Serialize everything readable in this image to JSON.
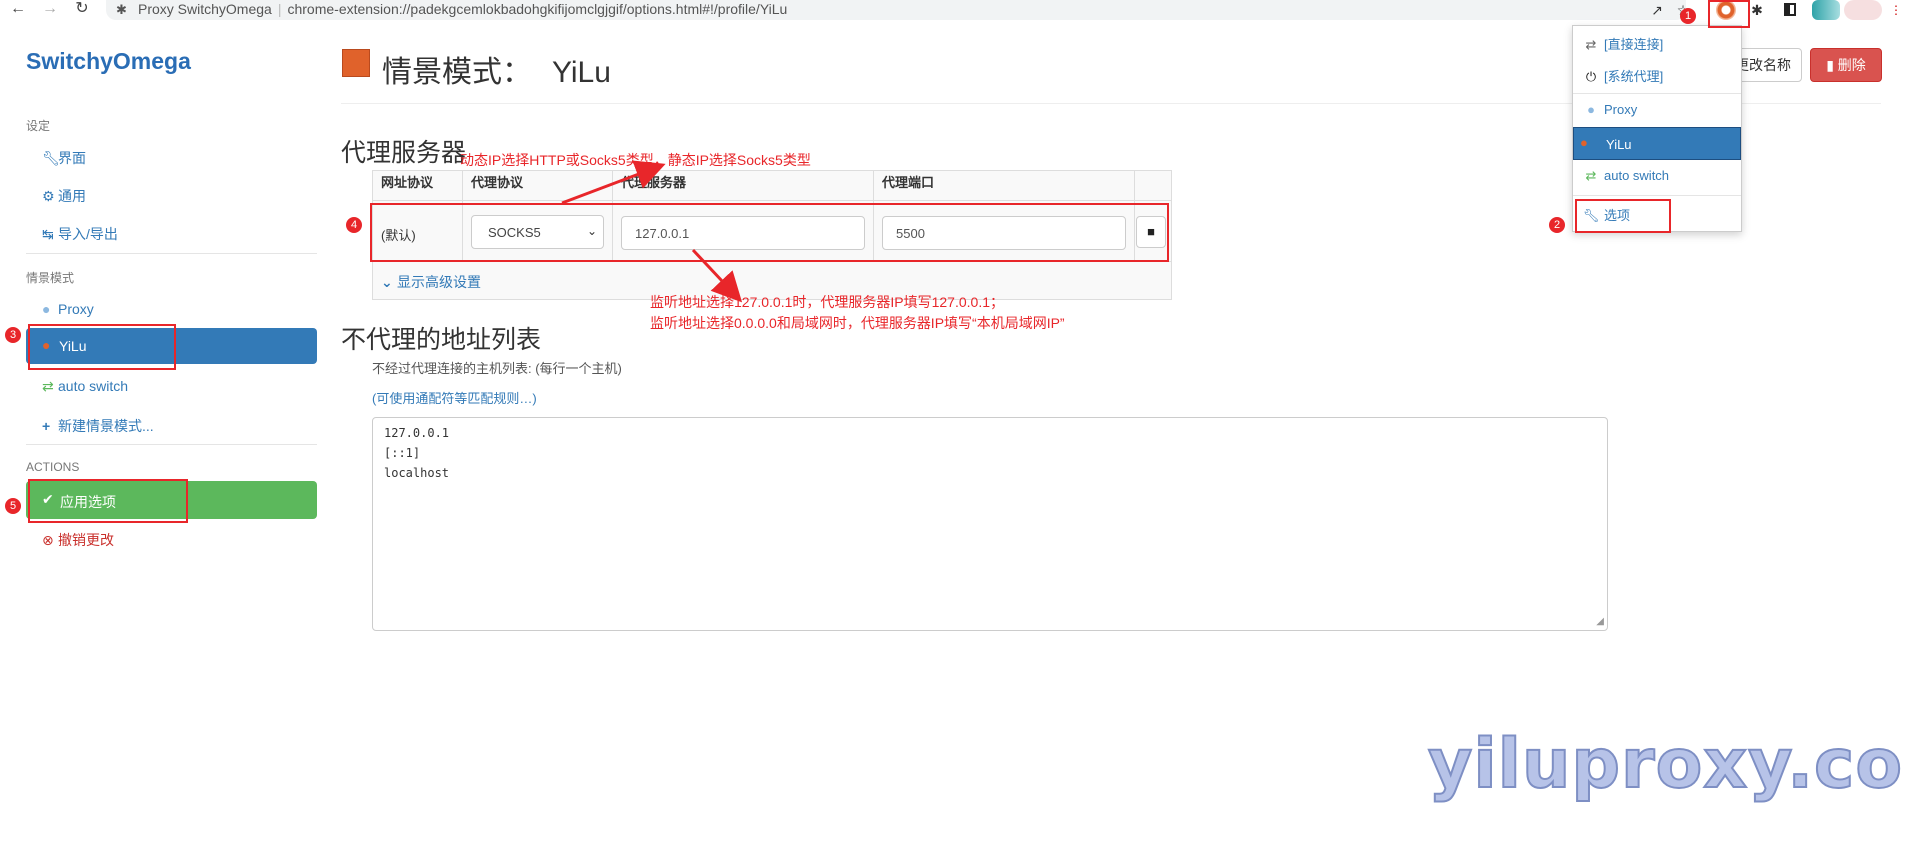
{
  "browser": {
    "tab_title": "Proxy SwitchyOmega",
    "url": "chrome-extension://padekgcemlokbadohgkifijomclgjgif/options.html#!/profile/YiLu"
  },
  "sidebar": {
    "brand": "SwitchyOmega",
    "settings_header": "设定",
    "settings_items": [
      {
        "label": "界面",
        "icon": "wrench-icon"
      },
      {
        "label": "通用",
        "icon": "gear-icon"
      },
      {
        "label": "导入/导出",
        "icon": "import-export-icon"
      }
    ],
    "profiles_header": "情景模式",
    "profiles": [
      {
        "label": "Proxy",
        "icon": "globe-icon"
      },
      {
        "label": "YiLu",
        "icon": "globe-icon",
        "active": true
      },
      {
        "label": "auto switch",
        "icon": "retweet-icon"
      }
    ],
    "new_profile": "新建情景模式...",
    "actions_header": "ACTIONS",
    "apply": "应用选项",
    "discard": "撤销更改"
  },
  "header": {
    "title_prefix": "情景模式：",
    "profile_name": "YiLu",
    "rename_button": "更改名称",
    "delete_button": "删除",
    "profile_color": "#e0622b"
  },
  "proxy_section": {
    "title": "代理服务器",
    "columns": [
      "网址协议",
      "代理协议",
      "代理服务器",
      "代理端口"
    ],
    "row": {
      "scheme": "(默认)",
      "protocol": "SOCKS5",
      "server": "127.0.0.1",
      "port": "5500"
    },
    "advanced": "显示高级设置"
  },
  "bypass_section": {
    "title": "不代理的地址列表",
    "description": "不经过代理连接的主机列表: (每行一个主机)",
    "wildcard_link": "(可使用通配符等匹配规则…)",
    "lines": [
      "127.0.0.1",
      "[::1]",
      "localhost"
    ]
  },
  "popup": {
    "items": [
      {
        "label": "[直接连接]",
        "icon": "swap-icon"
      },
      {
        "label": "[系统代理]",
        "icon": "power-icon"
      },
      {
        "label": "Proxy",
        "icon": "globe-icon"
      },
      {
        "label": "YiLu",
        "icon": "globe-icon",
        "active": true
      },
      {
        "label": "auto switch",
        "icon": "retweet-icon"
      },
      {
        "label": "选项",
        "icon": "wrench-icon"
      }
    ]
  },
  "annotations": {
    "note_protocol": "动态IP选择HTTP或Socks5类型，静态IP选择Socks5类型",
    "note_server_1": "监听地址选择127.0.0.1时，代理服务器IP填写127.0.0.1；",
    "note_server_2": "监听地址选择0.0.0.0和局域网时，代理服务器IP填写“本机局域网IP”",
    "badges": [
      "1",
      "2",
      "3",
      "4",
      "5"
    ],
    "color": "#e8262a"
  },
  "watermark": "yiluproxy.com"
}
